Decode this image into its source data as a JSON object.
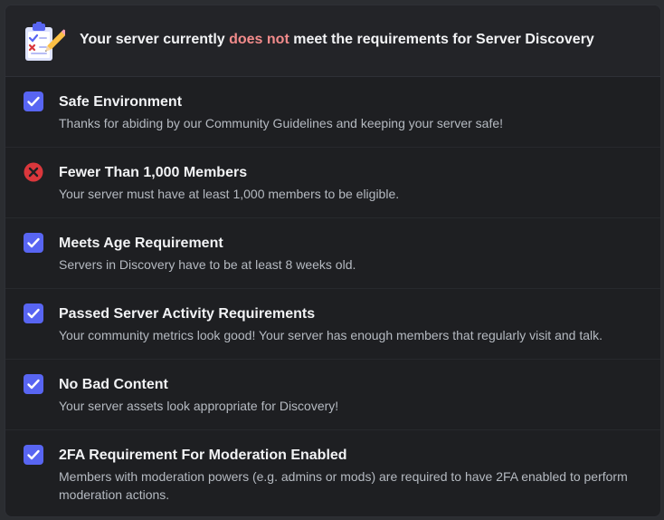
{
  "header": {
    "title_prefix": "Your server currently ",
    "title_highlight": "does not",
    "title_suffix": " meet the requirements for Server Discovery",
    "icon": "clipboard-checklist-icon"
  },
  "colors": {
    "check": "#5865f2",
    "error": "#da373c",
    "highlight": "#f28b8b"
  },
  "requirements": [
    {
      "status": "pass",
      "icon": "checkbox-checked-icon",
      "title": "Safe Environment",
      "description": "Thanks for abiding by our Community Guidelines and keeping your server safe!"
    },
    {
      "status": "fail",
      "icon": "error-x-icon",
      "title": "Fewer Than 1,000 Members",
      "description": "Your server must have at least 1,000 members to be eligible."
    },
    {
      "status": "pass",
      "icon": "checkbox-checked-icon",
      "title": "Meets Age Requirement",
      "description": "Servers in Discovery have to be at least 8 weeks old."
    },
    {
      "status": "pass",
      "icon": "checkbox-checked-icon",
      "title": "Passed Server Activity Requirements",
      "description": "Your community metrics look good! Your server has enough members that regularly visit and talk."
    },
    {
      "status": "pass",
      "icon": "checkbox-checked-icon",
      "title": "No Bad Content",
      "description": "Your server assets look appropriate for Discovery!"
    },
    {
      "status": "pass",
      "icon": "checkbox-checked-icon",
      "title": "2FA Requirement For Moderation Enabled",
      "description": "Members with moderation powers (e.g. admins or mods) are required to have 2FA enabled to perform moderation actions."
    }
  ]
}
